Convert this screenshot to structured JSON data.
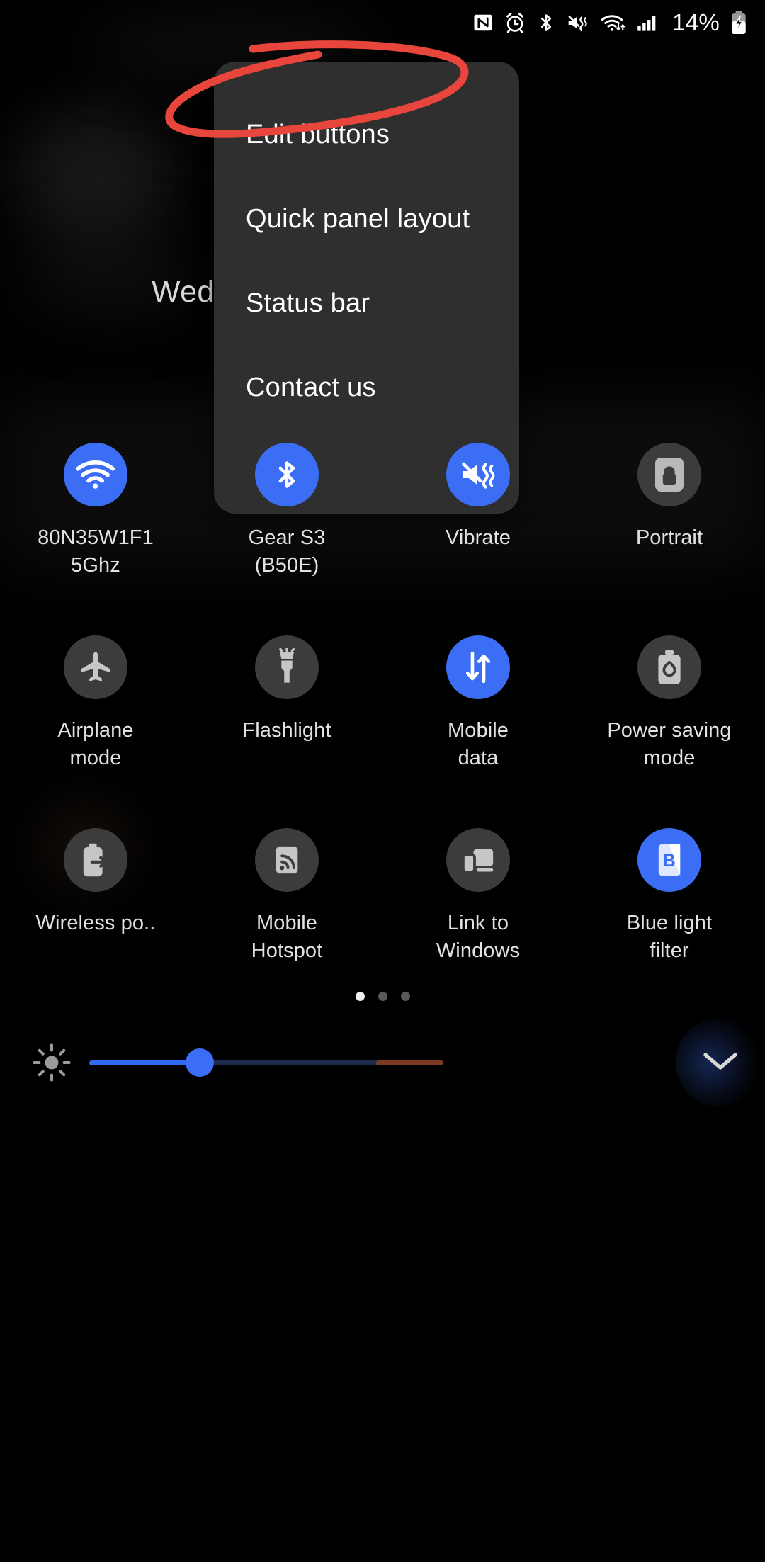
{
  "status_bar": {
    "battery_percent": "14%",
    "icons": [
      "nfc-icon",
      "alarm-icon",
      "bluetooth-icon",
      "vibrate-icon",
      "wifi-icon",
      "cellular-signal-icon",
      "battery-charging-icon"
    ]
  },
  "background": {
    "date_text": "Wed"
  },
  "menu": {
    "items": [
      {
        "label": "Edit buttons"
      },
      {
        "label": "Quick panel layout"
      },
      {
        "label": "Status bar"
      },
      {
        "label": "Contact us"
      }
    ]
  },
  "annotation": {
    "color": "#e8453c",
    "target": "Edit buttons",
    "shape": "hand-drawn-ellipse"
  },
  "colors": {
    "tile_on": "#3b6ef5",
    "tile_off": "#3c3c3c",
    "panel": "#2f2f2f",
    "slider_fill": "#2f6cf0",
    "slider_warm": "#7a3a22"
  },
  "quick_settings": {
    "rows": [
      [
        {
          "icon": "wifi-icon",
          "label": "80N35W1F1\n5Ghz",
          "active": true
        },
        {
          "icon": "bluetooth-icon",
          "label": "Gear S3\n(B50E)",
          "active": true
        },
        {
          "icon": "vibrate-icon",
          "label": "Vibrate",
          "active": true
        },
        {
          "icon": "rotation-lock-icon",
          "label": "Portrait",
          "active": false
        }
      ],
      [
        {
          "icon": "airplane-icon",
          "label": "Airplane\nmode",
          "active": false
        },
        {
          "icon": "flashlight-icon",
          "label": "Flashlight",
          "active": false
        },
        {
          "icon": "mobile-data-icon",
          "label": "Mobile\ndata",
          "active": true
        },
        {
          "icon": "power-saving-icon",
          "label": "Power saving\nmode",
          "active": false
        }
      ],
      [
        {
          "icon": "wireless-powershare-icon",
          "label": "Wireless po..",
          "active": false
        },
        {
          "icon": "mobile-hotspot-icon",
          "label": "Mobile\nHotspot",
          "active": false
        },
        {
          "icon": "link-to-windows-icon",
          "label": "Link to\nWindows",
          "active": false
        },
        {
          "icon": "blue-light-filter-icon",
          "label": "Blue light\nfilter",
          "active": true
        }
      ]
    ]
  },
  "page_indicator": {
    "total": 3,
    "current": 1
  },
  "brightness": {
    "icon": "brightness-icon",
    "value_percent": 31,
    "expand_icon": "chevron-down-icon"
  }
}
